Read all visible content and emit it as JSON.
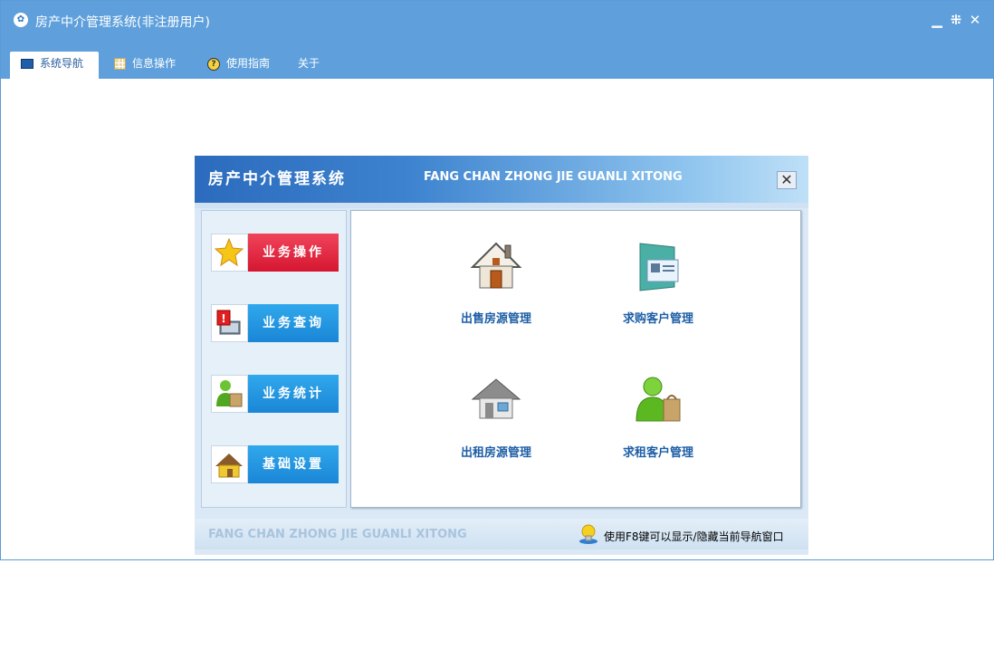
{
  "window": {
    "title": "房产中介管理系统(非注册用户)",
    "app_icon": "app-logo-icon",
    "controls": {
      "minimize": "minimize-icon",
      "restore": "restore-icon",
      "close": "close-icon"
    }
  },
  "menu": {
    "items": [
      {
        "label": "系统导航",
        "icon": "monitor-icon",
        "active": true
      },
      {
        "label": "信息操作",
        "icon": "grid-icon",
        "active": false
      },
      {
        "label": "使用指南",
        "icon": "help-icon",
        "active": false
      },
      {
        "label": "关于",
        "icon": "",
        "active": false
      }
    ]
  },
  "dialog": {
    "title": "房产中介管理系统",
    "subtitle": "FANG CHAN ZHONG JIE GUANLI XITONG",
    "close_glyph": "✕",
    "side_buttons": [
      {
        "label": "业务操作",
        "icon": "star-icon",
        "color": "#e0233b"
      },
      {
        "label": "业务查询",
        "icon": "alert-monitor-icon",
        "color": "#1f95e2"
      },
      {
        "label": "业务统计",
        "icon": "user-bag-icon",
        "color": "#1f95e2"
      },
      {
        "label": "基础设置",
        "icon": "house-tool-icon",
        "color": "#1f95e2"
      }
    ],
    "tiles": [
      {
        "label": "出售房源管理",
        "icon": "house-sale-icon"
      },
      {
        "label": "求购客户管理",
        "icon": "contact-card-icon"
      },
      {
        "label": "出租房源管理",
        "icon": "house-rent-icon"
      },
      {
        "label": "求租客户管理",
        "icon": "user-shopping-icon"
      }
    ],
    "footer_text": "FANG CHAN ZHONG JIE GUANLI XITONG",
    "footer_hint": "使用F8键可以显示/隐藏当前导航窗口"
  }
}
